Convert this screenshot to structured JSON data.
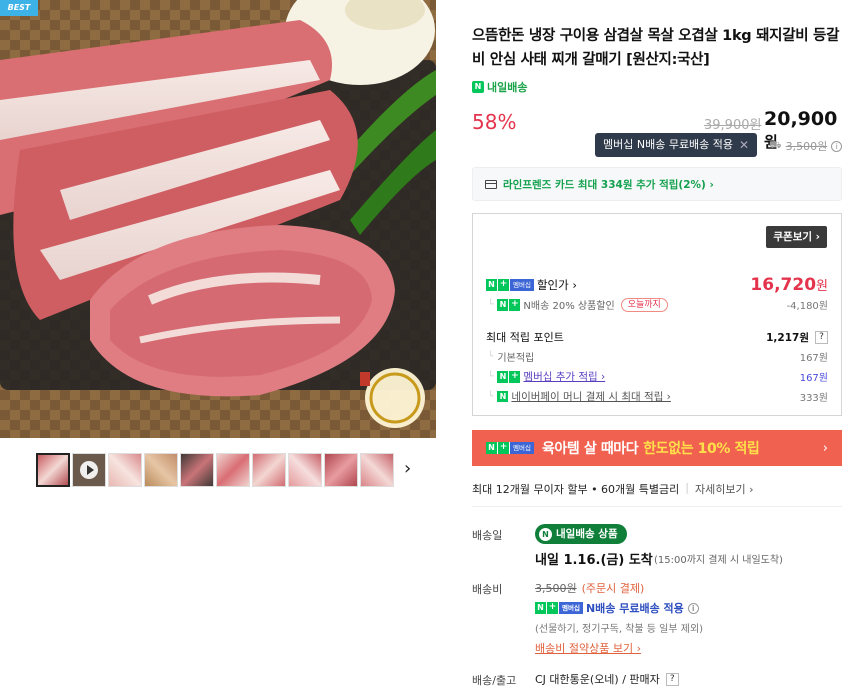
{
  "badge": "BEST",
  "product": {
    "title": "으뜸한돈 냉장 구이용 삼겹살 목살 오겹살 1kg 돼지갈비 등갈비 안심 사태 찌개 갈매기 [원산지:국산]",
    "tomorrow_tag": "내일배송",
    "discount_rate": "58%",
    "original_price": "39,900원",
    "sale_price": "20,900",
    "sale_price_unit": "원"
  },
  "tooltip": {
    "text": "멤버십 N배송 무료배송 적용"
  },
  "shipping_inline": {
    "fee": "3,500원"
  },
  "card_offer": {
    "text": "라인프렌즈 카드 최대 334원 추가 적립(2%) ›"
  },
  "benefits": {
    "coupon_button": "쿠폰보기 ›",
    "discount_label": "할인가 ›",
    "discount_value": "16,720",
    "discount_unit": "원",
    "ndelivery_discount_label": "N배송 20% 상품할인",
    "today_pill": "오늘까지",
    "ndelivery_discount_value": "-4,180원",
    "points_label": "최대 적립 포인트",
    "points_value": "1,217원",
    "basic_label": "기본적립",
    "basic_value": "167원",
    "membership_label": "멤버십 추가 적립 ›",
    "membership_value": "167원",
    "npay_label": "네이버페이 머니 결제 시 최대 적립 ›",
    "npay_value": "333원"
  },
  "banner": {
    "text": "육아템 살 때마다",
    "highlight": "한도없는 10% 적립"
  },
  "installment": {
    "text": "최대 12개월 무이자 할부 • 60개월 특별금리",
    "detail": "자세히보기 ›"
  },
  "delivery": {
    "date_label": "배송일",
    "pill": "내일배송 상품",
    "arrival": "내일 1.16.(금) 도착",
    "arrival_note": "(15:00까지 결제 시 내일도착)",
    "fee_label": "배송비",
    "fee_strike": "3,500원",
    "fee_note": "(주문시 결제)",
    "nfree": "N배송 무료배송 적용",
    "exclusion": "(선물하기, 정기구독, 착불 등 일부 제외)",
    "save_link": "배송비 절약상품 보기 ›",
    "carrier_label": "배송/출고",
    "carrier": "CJ 대한통운(오네) / 판매자"
  },
  "colors": {
    "discount_red": "#e4344d",
    "naver_green": "#03c75a",
    "banner": "#f1614f",
    "membership_blue": "#3c66d6"
  }
}
